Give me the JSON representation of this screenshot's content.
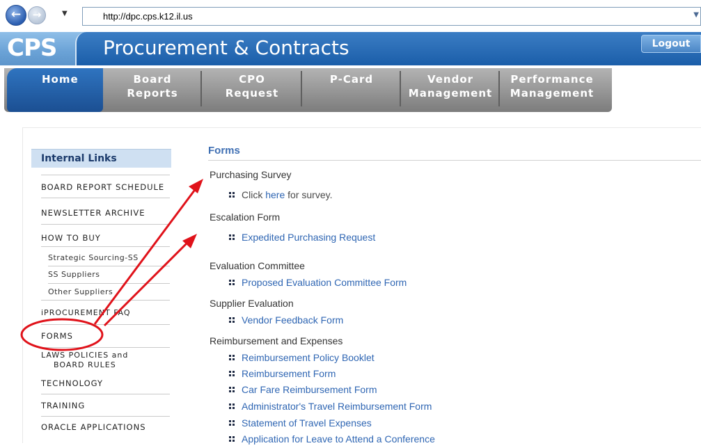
{
  "browser": {
    "back_icon": "back-arrow-icon",
    "forward_icon": "forward-arrow-icon",
    "url": "http://dpc.cps.k12.il.us"
  },
  "header": {
    "logo": "CPS",
    "title": "Procurement & Contracts",
    "logout": "Logout"
  },
  "tabs": [
    {
      "line1": "Home",
      "line2": ""
    },
    {
      "line1": "Board",
      "line2": "Reports"
    },
    {
      "line1": "CPO",
      "line2": "Request"
    },
    {
      "line1": "P-Card",
      "line2": ""
    },
    {
      "line1": "Vendor",
      "line2": "Management"
    },
    {
      "line1": "Performance",
      "line2": "Management"
    }
  ],
  "sidebar": {
    "heading": "Internal Links",
    "items": [
      "BOARD REPORT SCHEDULE",
      "NEWSLETTER ARCHIVE",
      "HOW TO BUY",
      "iPROCUREMENT FAQ",
      "FORMS",
      "LAWS POLICIES and",
      "BOARD RULES",
      "TECHNOLOGY",
      "TRAINING",
      "ORACLE APPLICATIONS"
    ],
    "subitems": [
      "Strategic Sourcing-SS",
      "SS Suppliers",
      "Other Suppliers"
    ]
  },
  "main": {
    "title": "Forms",
    "sections": [
      {
        "title": "Purchasing Survey"
      },
      {
        "title": "Escalation Form"
      },
      {
        "title": "Evaluation Committee"
      },
      {
        "title": "Supplier Evaluation"
      },
      {
        "title": "Reimbursement and Expenses"
      }
    ],
    "survey": {
      "prefix": "Click ",
      "link": "here",
      "suffix": " for survey."
    },
    "links": [
      "Expedited Purchasing Request",
      "Proposed Evaluation Committee Form",
      "Vendor Feedback Form",
      "Reimbursement Policy Booklet",
      "Reimbursement Form",
      "Car Fare Reimbursement Form",
      "Administrator's Travel Reimbursement Form",
      "Statement of Travel Expenses",
      "Application for Leave to Attend a Conference"
    ]
  },
  "colors": {
    "annotation": "#e0121a",
    "link": "#2f66b3",
    "tab_active": "#2f74c0"
  }
}
